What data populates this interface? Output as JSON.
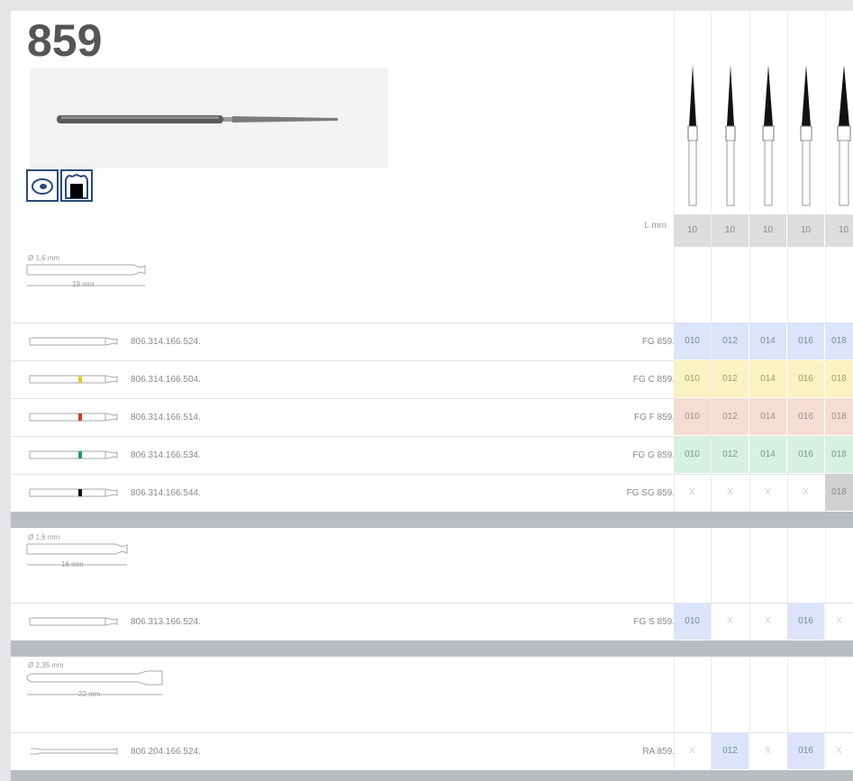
{
  "header": {
    "title": "859"
  },
  "icons": [
    "pulp-icon",
    "crown-prep-icon"
  ],
  "lmm": {
    "label": "L mm",
    "values": [
      "10",
      "10",
      "10",
      "10",
      "10"
    ]
  },
  "groups": [
    {
      "diameter": "Ø 1,6 mm",
      "length": "19 mm",
      "rows": [
        {
          "code": "806.314.166.524.",
          "type": "FG 859.",
          "band": "none",
          "bg": "#dbe4f8",
          "cells": [
            "010",
            "012",
            "014",
            "016",
            "018"
          ]
        },
        {
          "code": "806.314.166.504.",
          "type": "FG C 859.",
          "band": "yellow",
          "bg": "#fbf2c2",
          "cells": [
            "010",
            "012",
            "014",
            "016",
            "018"
          ]
        },
        {
          "code": "806.314.166.514.",
          "type": "FG F 859.",
          "band": "red",
          "bg": "#f6ddd4",
          "cells": [
            "010",
            "012",
            "014",
            "016",
            "018"
          ]
        },
        {
          "code": "806.314.166.534.",
          "type": "FG G 859.",
          "band": "green",
          "bg": "#d6f0e2",
          "cells": [
            "010",
            "012",
            "014",
            "016",
            "018"
          ]
        },
        {
          "code": "806.314.166.544.",
          "type": "FG SG 859.",
          "band": "black",
          "bg": "#ffffff",
          "cells": [
            "X",
            "X",
            "X",
            "X",
            "018"
          ]
        }
      ]
    },
    {
      "diameter": "Ø 1,6 mm",
      "length": "16 mm",
      "rows": [
        {
          "code": "806.313.166.524.",
          "type": "FG S 859.",
          "band": "none",
          "bg": "#ffffff",
          "cells": [
            "010",
            "X",
            "X",
            "016",
            "X"
          ]
        }
      ]
    },
    {
      "diameter": "Ø 2,35 mm",
      "length": "22 mm",
      "rows": [
        {
          "code": "806.204.166.524.",
          "type": "RA 859.",
          "band": "none",
          "bg": "#ffffff",
          "cells": [
            "X",
            "012",
            "X",
            "016",
            "X"
          ]
        }
      ]
    }
  ],
  "colors": {
    "blue": "#dbe4f8",
    "yellow": "#fbf2c2",
    "red": "#f6ddd4",
    "green": "#d6f0e2",
    "grey": "#d0d0d0",
    "separator": "#b9bcc0"
  }
}
